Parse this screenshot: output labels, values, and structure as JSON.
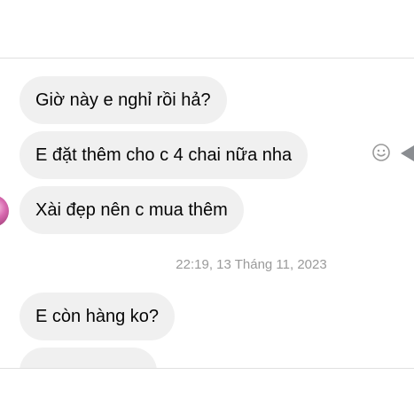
{
  "messages": [
    {
      "text": "Giờ này e nghỉ rồi hả?"
    },
    {
      "text": "E đặt thêm cho c 4 chai nữa nha"
    },
    {
      "text": "Xài đẹp nên c mua thêm"
    }
  ],
  "timestamp": "22:19, 13 Tháng 11, 2023",
  "after_timestamp_messages": [
    {
      "text": "E còn hàng ko?"
    }
  ],
  "icons": {
    "react": "smiley-face-icon",
    "more": "arrow-left-icon",
    "avatar": "avatar"
  },
  "colors": {
    "bubble": "#f0f0f0",
    "text": "#050505",
    "timestamp": "#9a9a9a"
  }
}
